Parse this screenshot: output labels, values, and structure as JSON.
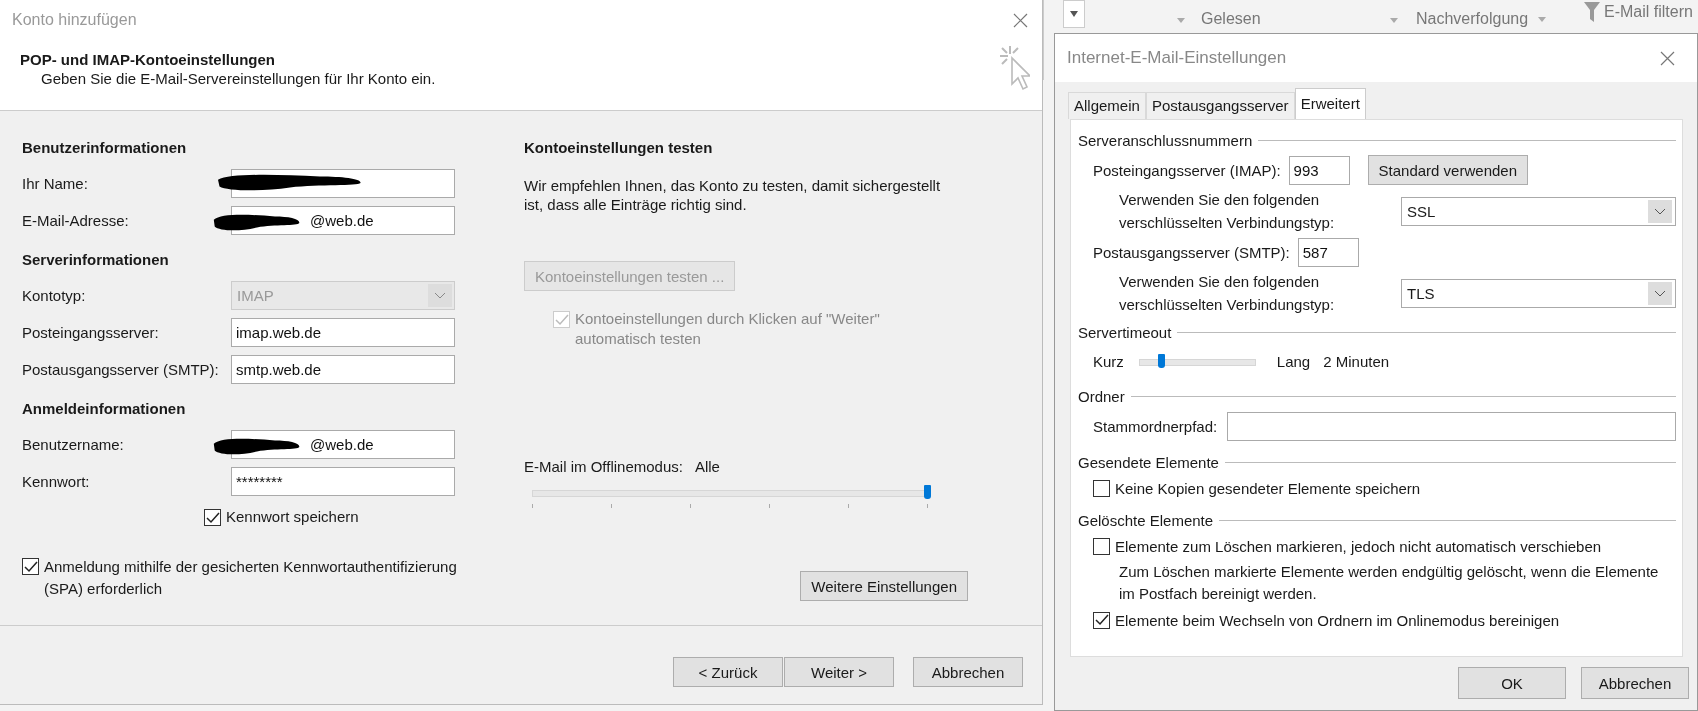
{
  "background_ribbon": {
    "items": [
      {
        "label": "Gelesen"
      },
      {
        "label": "Nachverfolgung"
      },
      {
        "label": "E-Mail filtern"
      }
    ]
  },
  "account_dialog": {
    "title": "Konto hinzufügen",
    "heading": "POP- und IMAP-Kontoeinstellungen",
    "subheading": "Geben Sie die E-Mail-Servereinstellungen für Ihr Konto ein.",
    "sections": [
      {
        "title": "Benutzerinformationen",
        "fields": [
          {
            "label": "Ihr Name:",
            "kind": "text",
            "redacted": true,
            "disabled": false
          },
          {
            "label": "E-Mail-Adresse:",
            "kind": "text",
            "value": "@web.de",
            "redacted": true,
            "disabled": false
          }
        ]
      },
      {
        "title": "Serverinformationen",
        "fields": [
          {
            "label": "Kontotyp:",
            "kind": "select",
            "value": "IMAP",
            "redacted": false,
            "disabled": true
          },
          {
            "label": "Posteingangsserver:",
            "kind": "text",
            "value": "imap.web.de",
            "redacted": false,
            "disabled": false
          },
          {
            "label": "Postausgangsserver (SMTP):",
            "kind": "text",
            "value": "smtp.web.de",
            "redacted": false,
            "disabled": false
          }
        ]
      },
      {
        "title": "Anmeldeinformationen",
        "fields": [
          {
            "label": "Benutzername:",
            "kind": "text",
            "value": "@web.de",
            "redacted": true,
            "disabled": false
          },
          {
            "label": "Kennwort:",
            "kind": "text",
            "value": "********",
            "redacted": false,
            "disabled": false
          }
        ]
      }
    ],
    "remember_password": {
      "label": "Kennwort speichern",
      "checked": true
    },
    "spa": {
      "label": "Anmeldung mithilfe der gesicherten Kennwortauthentifizierung (SPA) erforderlich",
      "checked": true
    },
    "test": {
      "title": "Kontoeinstellungen testen",
      "description": "Wir empfehlen Ihnen, das Konto zu testen, damit sichergestellt ist, dass alle Einträge richtig sind.",
      "button": {
        "label": "Kontoeinstellungen testen ...",
        "disabled": true
      },
      "auto_test": {
        "label": "Kontoeinstellungen durch Klicken auf \"Weiter\" automatisch testen",
        "checked": true,
        "disabled": true
      }
    },
    "offline": {
      "label": "E-Mail im Offlinemodus:",
      "value": "Alle",
      "level": 1
    },
    "more_button": "Weitere Einstellungen",
    "buttons": [
      "< Zurück",
      "Weiter >",
      "Abbrechen"
    ]
  },
  "internet_settings": {
    "title": "Internet-E-Mail-Einstellungen",
    "tabs": [
      {
        "label": "Allgemein",
        "selected": false
      },
      {
        "label": "Postausgangsserver",
        "selected": false
      },
      {
        "label": "Erweitert",
        "selected": true
      }
    ],
    "ports": {
      "title": "Serveranschlussnummern",
      "incoming": {
        "label": "Posteingangsserver (IMAP):",
        "value": "993"
      },
      "default_button": "Standard verwenden",
      "incoming_encryption": {
        "label": "Verwenden Sie den folgenden verschlüsselten Verbindungstyp:",
        "value": "SSL"
      },
      "outgoing": {
        "label": "Postausgangsserver (SMTP):",
        "value": "587"
      },
      "outgoing_encryption": {
        "label": "Verwenden Sie den folgenden verschlüsselten Verbindungstyp:",
        "value": "TLS"
      }
    },
    "timeout": {
      "title": "Servertimeout",
      "min_label": "Kurz",
      "max_label": "Lang",
      "level": 0.2,
      "reading": "2 Minuten"
    },
    "folders": {
      "title": "Ordner",
      "root_label": "Stammordnerpfad:"
    },
    "sent": {
      "title": "Gesendete Elemente",
      "options": [
        {
          "kind": "checkbox",
          "label": "Keine Kopien gesendeter Elemente speichern",
          "checked": false
        }
      ]
    },
    "deleted": {
      "title": "Gelöschte Elemente",
      "options": [
        {
          "kind": "checkbox",
          "label": "Elemente zum Löschen markieren, jedoch nicht automatisch verschieben",
          "checked": false
        },
        {
          "kind": "note",
          "label": "Zum Löschen markierte Elemente werden endgültig gelöscht, wenn die Elemente im Postfach bereinigt werden."
        },
        {
          "kind": "checkbox",
          "label": "Elemente beim Wechseln von Ordnern im Onlinemodus bereinigen",
          "checked": true
        }
      ]
    },
    "buttons": [
      "OK",
      "Abbrechen"
    ]
  }
}
